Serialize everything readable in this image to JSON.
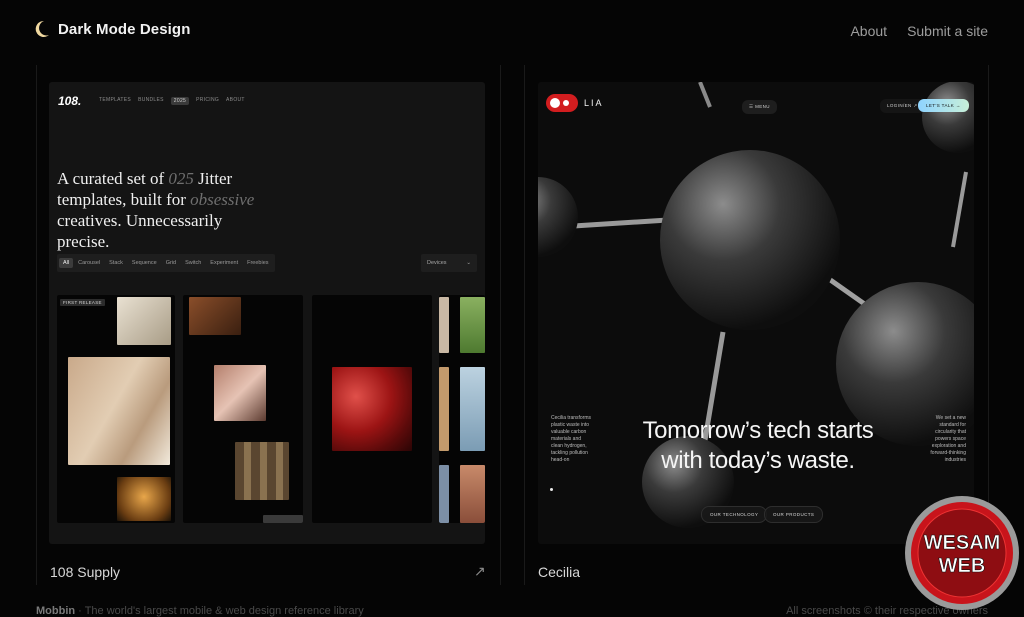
{
  "header": {
    "brand_title": "Dark Mode Design",
    "nav": [
      {
        "label": "About"
      },
      {
        "label": "Submit a site"
      }
    ]
  },
  "cards": [
    {
      "label": "108 Supply",
      "preview": {
        "logo": "108.",
        "nav": [
          "TEMPLATES",
          "BUNDLES",
          "2025",
          "PRICING",
          "ABOUT"
        ],
        "headline_line1_a": "A curated set of ",
        "headline_line1_b": "025",
        "headline_line1_c": " Jitter",
        "headline_line2_a": "templates, built for ",
        "headline_line2_b": "obsessive",
        "headline_line3": "creatives. Unnecessarily precise.",
        "filters": [
          "All",
          "Carousel",
          "Stack",
          "Sequence",
          "Grid",
          "Switch",
          "Experiment",
          "Freebies"
        ],
        "devices_label": "Devices",
        "tile_badge": "FIRST RELEASE"
      }
    },
    {
      "label": "Cecilia",
      "preview": {
        "logo_text": "LIA",
        "menu_label": "☰ MENU",
        "login_label": "LOGIN/EN ↗",
        "talk_label": "LET'S TALK →",
        "headline_line1": "Tomorrow’s tech starts",
        "headline_line2": "with today’s waste.",
        "left_copy": "Cecilia transforms plastic waste into valuable carbon materials and clean hydrogen, tackling pollution head-on",
        "right_copy": "We set a new standard for circularity that powers space exploration and forward-thinking industries",
        "button_technology": "OUR TECHNOLOGY",
        "button_products": "OUR PRODUCTS"
      }
    }
  ],
  "footer": {
    "brand": "Mobbin",
    "tagline": "· The world's largest mobile & web design reference library",
    "credit": "All screenshots © their respective owners"
  },
  "watermark": {
    "line1": "WESAM",
    "line2": "WEB"
  },
  "colors": {
    "background": "#050505",
    "card_a": "#141414",
    "card_b": "#0c0c0c",
    "accent_red": "#d21d1f"
  },
  "icons": {
    "brand": "crescent-moon-icon",
    "card_link": "external-arrow-icon"
  }
}
